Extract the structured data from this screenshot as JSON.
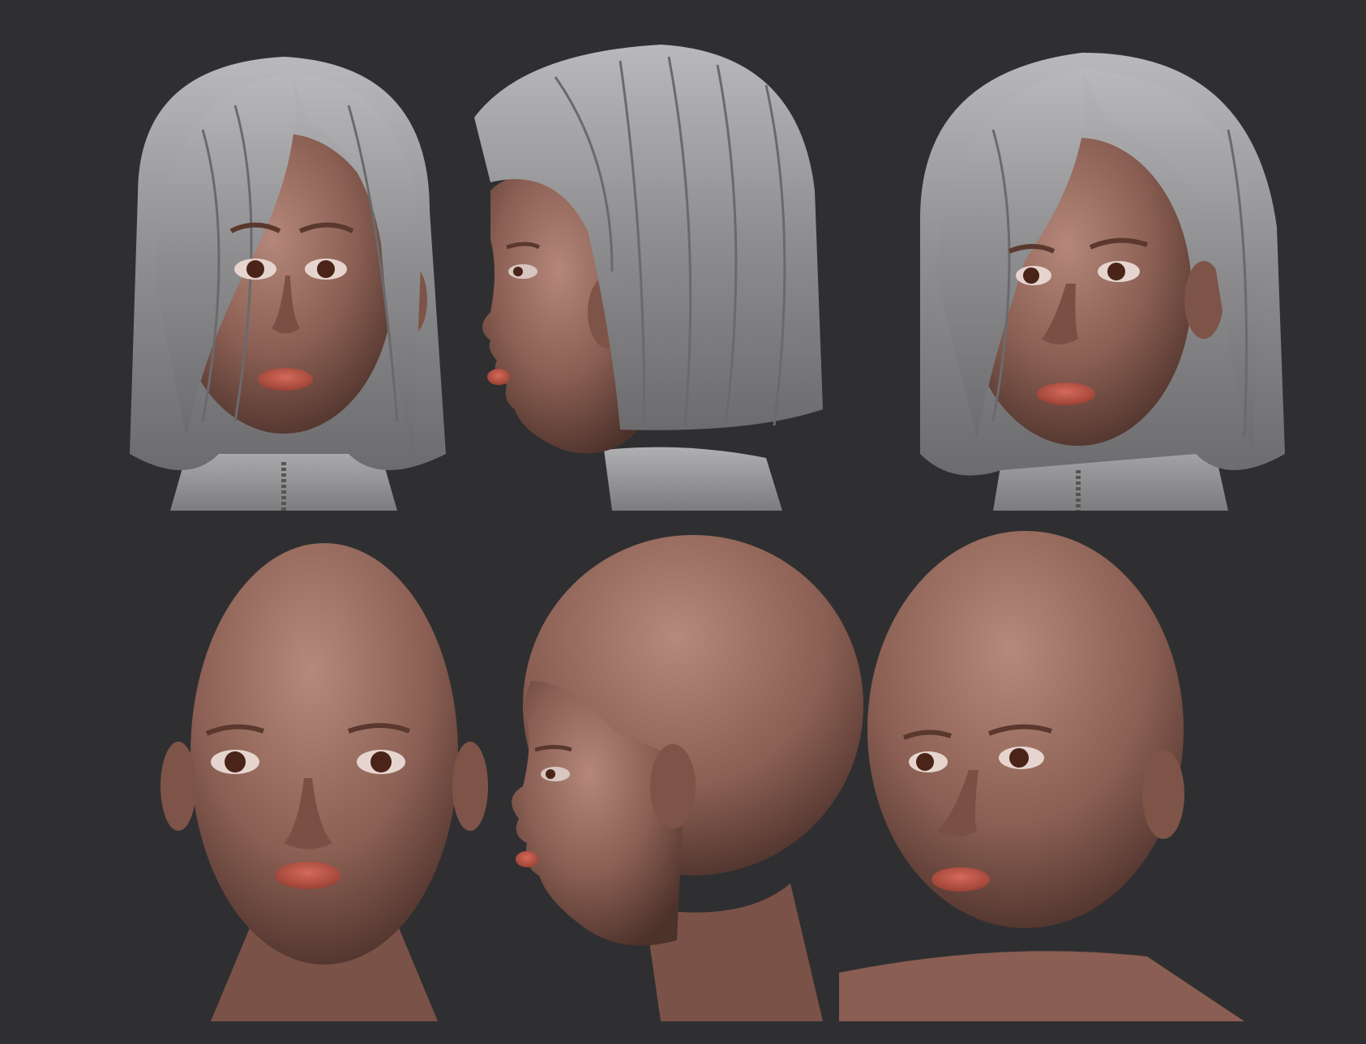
{
  "scene": {
    "background_color": "#2f2f31",
    "hair_color": "#8e8e90",
    "hair_highlight": "#bdbdbf",
    "skin_color": "#8a5e52",
    "skin_highlight": "#b08474",
    "lip_color": "#c2584a",
    "iris_color": "#4a2418",
    "collar_color": "#9a9a9c"
  },
  "views": [
    {
      "row": "hair",
      "angle": "front"
    },
    {
      "row": "hair",
      "angle": "profile"
    },
    {
      "row": "hair",
      "angle": "three-quarter"
    },
    {
      "row": "bald",
      "angle": "front"
    },
    {
      "row": "bald",
      "angle": "profile"
    },
    {
      "row": "bald",
      "angle": "three-quarter"
    }
  ]
}
